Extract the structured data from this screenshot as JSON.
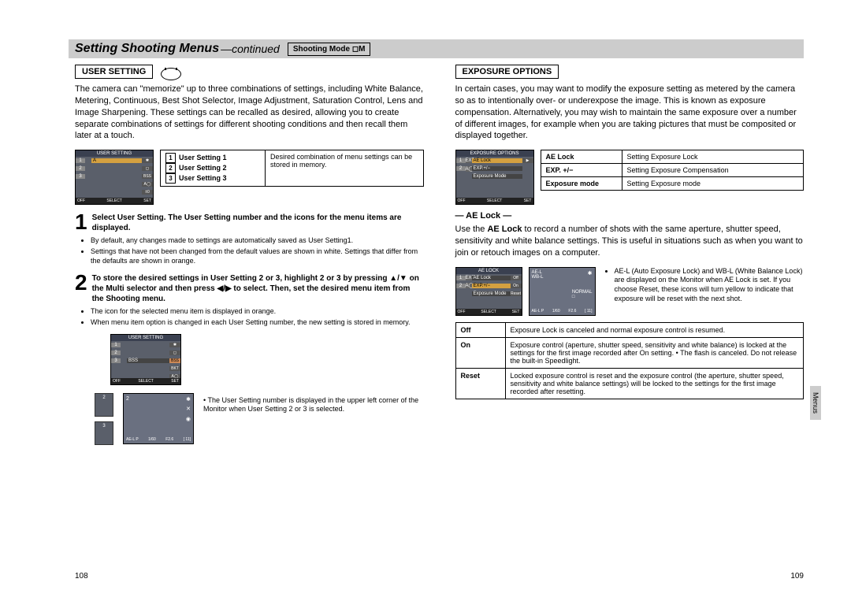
{
  "header": {
    "title": "Setting Shooting Menus",
    "sub": "—continued",
    "mode_label": "Shooting Mode"
  },
  "left": {
    "section_heading": "USER SETTING",
    "intro": "The camera can \"memorize\" up to three combinations of settings, including White Balance, Metering, Continuous, Best Shot Selector, Image Adjustment, Saturation Control, Lens and Image Sharpening. These settings can be recalled as desired, allowing you to create separate combinations of settings for different shooting conditions and then recall them later at a touch.",
    "screenshot1_title": "USER SETTING",
    "menu_items": [
      "1",
      "2",
      "3"
    ],
    "menu_footer_off": "OFF",
    "menu_footer_select": "SELECT",
    "menu_footer_set": "SET",
    "user_setting_rows": [
      "User Setting 1",
      "User Setting 2",
      "User Setting 3"
    ],
    "user_setting_desc": "Desired combination of menu settings can be stored in memory.",
    "step1_text": "Select User Setting. The User Setting number and the icons for the menu items are displayed.",
    "step1_bullets": [
      "By default, any changes made to settings are automatically saved as User Setting1.",
      "Settings that have not been changed from the default values are shown in white. Settings that differ from the defaults are shown in orange."
    ],
    "step2_text": "To store the desired settings in User Setting 2 or 3, highlight 2 or 3 by pressing ▲/▼ on the Multi selector and then press ◀/▶ to select. Then, set the desired menu item from the Shooting menu.",
    "step2_bullets": [
      "The icon for the selected menu item is displayed in orange.",
      "When menu item option is changed in each User Setting number, the new setting is stored in memory."
    ],
    "screenshot2_title": "USER SETTING",
    "ss2_item": "BSS",
    "corner_caption": "The User Setting number is displayed in the upper left corner of the Monitor when User Setting 2 or 3 is selected."
  },
  "right": {
    "section_heading": "EXPOSURE OPTIONS",
    "intro": "In certain cases, you may want to modify the exposure setting as metered by the camera so as to intentionally over- or underexpose the image. This is known as exposure compensation. Alternatively, you may wish to maintain the same exposure over a number of different images, for example when you are taking pictures that must be composited or displayed together.",
    "screenshot_title": "EXPOSURE OPTIONS",
    "ss_rows": [
      {
        "label": "AE Lock",
        "val": ""
      },
      {
        "label": "EXP.+/−",
        "val": ""
      },
      {
        "label": "Exposure Mode",
        "val": ""
      }
    ],
    "opt_table": [
      {
        "k": "AE Lock",
        "v": "Setting Exposure Lock"
      },
      {
        "k": "EXP. +/−",
        "v": "Setting Exposure Compensation"
      },
      {
        "k": "Exposure mode",
        "v": "Setting Exposure mode"
      }
    ],
    "ae_heading": "— AE Lock —",
    "ae_intro_pre": "Use the ",
    "ae_intro_bold": "AE Lock",
    "ae_intro_post": " to record a number of shots with the same aperture, shutter speed, sensitivity and white balance settings. This is useful in situations such as when you want to join or retouch images on a computer.",
    "mini_ss_title": "AE LOCK",
    "mini_ss_rows": [
      {
        "label": "AE Lock",
        "val": "Off"
      },
      {
        "label": "EXP.+/−",
        "val": "On"
      },
      {
        "label": "Exposure Mode",
        "val": "Reset"
      }
    ],
    "ae_notes": "AE-L (Auto Exposure Lock) and WB-L (White Balance Lock) are displayed on the Monitor when AE Lock is set. If you choose Reset, these icons will turn yellow to indicate that exposure will be reset with the next shot.",
    "ae_table": [
      {
        "k": "Off",
        "v": "Exposure Lock is canceled and normal exposure control is resumed."
      },
      {
        "k": "On",
        "v": "Exposure control (aperture, shutter speed, sensitivity and white balance) is locked at the settings for the first image recorded after On setting.\n• The flash is canceled. Do not release the built-in Speedlight."
      },
      {
        "k": "Reset",
        "v": "Locked exposure control is reset and the exposure control (the aperture, shutter speed, sensitivity and white balance settings) will be locked to the settings for the first image recorded after resetting."
      }
    ]
  },
  "page_left": "108",
  "page_right": "109",
  "side_tab": "Menus"
}
